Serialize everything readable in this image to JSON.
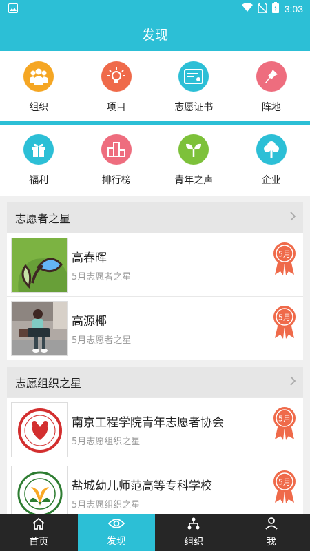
{
  "status": {
    "time": "3:03"
  },
  "header": {
    "title": "发现"
  },
  "grid_row1": [
    {
      "label": "组织",
      "icon": "people-icon",
      "color": "#f5a623"
    },
    {
      "label": "项目",
      "icon": "lightbulb-icon",
      "color": "#ef6a4a"
    },
    {
      "label": "志愿证书",
      "icon": "certificate-icon",
      "color": "#2cbfd6"
    },
    {
      "label": "阵地",
      "icon": "map-pin-icon",
      "color": "#ee6d7e"
    }
  ],
  "grid_row2": [
    {
      "label": "福利",
      "icon": "gift-icon",
      "color": "#2cbfd6"
    },
    {
      "label": "排行榜",
      "icon": "podium-icon",
      "color": "#ee6d7e"
    },
    {
      "label": "青年之声",
      "icon": "sprout-icon",
      "color": "#7dc13a"
    },
    {
      "label": "企业",
      "icon": "tree-icon",
      "color": "#2cbfd6"
    }
  ],
  "volunteer_stars": {
    "title": "志愿者之星",
    "items": [
      {
        "name": "高春晖",
        "subtitle": "5月志愿者之星",
        "badge": "5月"
      },
      {
        "name": "高源椰",
        "subtitle": "5月志愿者之星",
        "badge": "5月"
      }
    ]
  },
  "org_stars": {
    "title": "志愿组织之星",
    "items": [
      {
        "name": "南京工程学院青年志愿者协会",
        "subtitle": "5月志愿组织之星",
        "badge": "5月"
      },
      {
        "name": "盐城幼儿师范高等专科学校",
        "subtitle": "5月志愿组织之星",
        "badge": "5月"
      }
    ]
  },
  "bottom_nav": [
    {
      "label": "首页",
      "icon": "home-icon"
    },
    {
      "label": "发现",
      "icon": "eye-icon"
    },
    {
      "label": "组织",
      "icon": "org-chart-icon"
    },
    {
      "label": "我",
      "icon": "person-icon"
    }
  ],
  "colors": {
    "accent": "#2cbfd6",
    "badge": "#ef6a4a",
    "nav_bg": "#262626"
  }
}
